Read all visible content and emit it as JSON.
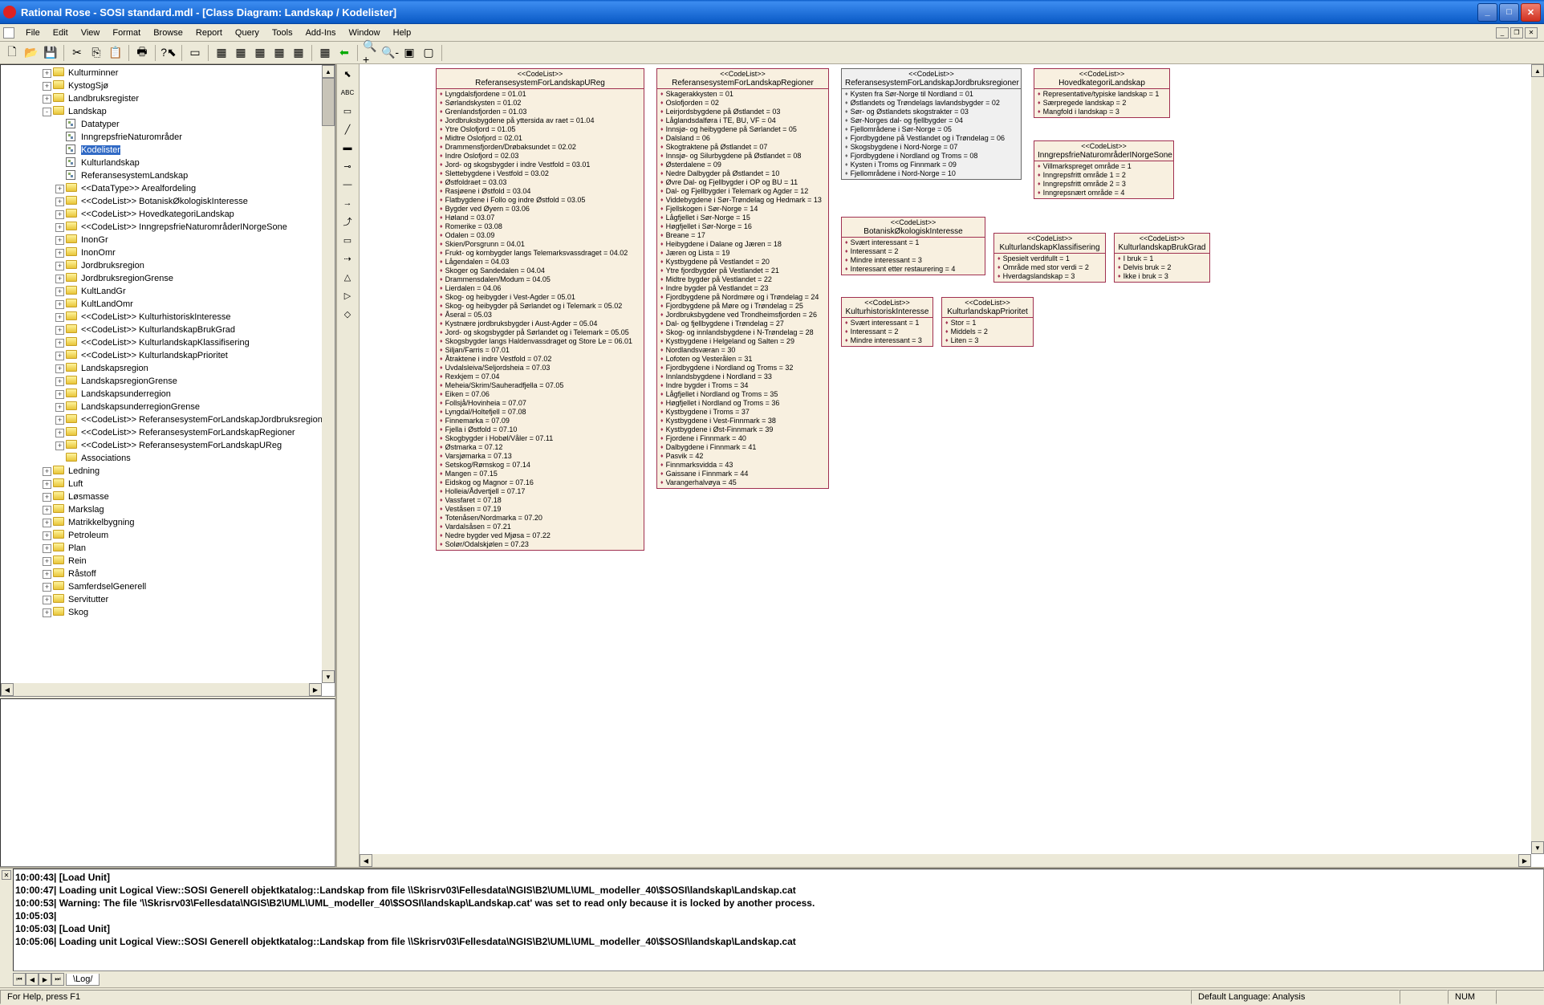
{
  "title": "Rational Rose - SOSI standard.mdl - [Class Diagram: Landskap / Kodelister]",
  "menu": [
    "File",
    "Edit",
    "View",
    "Format",
    "Browse",
    "Report",
    "Query",
    "Tools",
    "Add-Ins",
    "Window",
    "Help"
  ],
  "tree": {
    "top": [
      {
        "level": 1,
        "exp": "+",
        "icon": "folder",
        "label": "Kulturminner"
      },
      {
        "level": 1,
        "exp": "+",
        "icon": "folder",
        "label": "KystogSjø"
      },
      {
        "level": 1,
        "exp": "+",
        "icon": "folder",
        "label": "Landbruksregister"
      },
      {
        "level": 1,
        "exp": "-",
        "icon": "folder",
        "label": "Landskap"
      },
      {
        "level": 2,
        "exp": "",
        "icon": "diag",
        "label": "Datatyper"
      },
      {
        "level": 2,
        "exp": "",
        "icon": "diag",
        "label": "InngrepsfrieNaturområder"
      },
      {
        "level": 2,
        "exp": "",
        "icon": "diag",
        "label": "Kodelister",
        "selected": true
      },
      {
        "level": 2,
        "exp": "",
        "icon": "diag",
        "label": "Kulturlandskap"
      },
      {
        "level": 2,
        "exp": "",
        "icon": "diag",
        "label": "ReferansesystemLandskap"
      },
      {
        "level": 2,
        "exp": "+",
        "icon": "folder",
        "label": "<<DataType>> Arealfordeling"
      },
      {
        "level": 2,
        "exp": "+",
        "icon": "folder",
        "label": "<<CodeList>> BotaniskØkologiskInteresse"
      },
      {
        "level": 2,
        "exp": "+",
        "icon": "folder",
        "label": "<<CodeList>> HovedkategoriLandskap"
      },
      {
        "level": 2,
        "exp": "+",
        "icon": "folder",
        "label": "<<CodeList>> InngrepsfrieNaturområderINorgeSone"
      },
      {
        "level": 2,
        "exp": "+",
        "icon": "folder",
        "label": "InonGr"
      },
      {
        "level": 2,
        "exp": "+",
        "icon": "folder",
        "label": "InonOmr"
      },
      {
        "level": 2,
        "exp": "+",
        "icon": "folder",
        "label": "Jordbruksregion"
      },
      {
        "level": 2,
        "exp": "+",
        "icon": "folder",
        "label": "JordbruksregionGrense"
      },
      {
        "level": 2,
        "exp": "+",
        "icon": "folder",
        "label": "KultLandGr"
      },
      {
        "level": 2,
        "exp": "+",
        "icon": "folder",
        "label": "KultLandOmr"
      },
      {
        "level": 2,
        "exp": "+",
        "icon": "folder",
        "label": "<<CodeList>> KulturhistoriskInteresse"
      },
      {
        "level": 2,
        "exp": "+",
        "icon": "folder",
        "label": "<<CodeList>> KulturlandskapBrukGrad"
      },
      {
        "level": 2,
        "exp": "+",
        "icon": "folder",
        "label": "<<CodeList>> KulturlandskapKlassifisering"
      },
      {
        "level": 2,
        "exp": "+",
        "icon": "folder",
        "label": "<<CodeList>> KulturlandskapPrioritet"
      },
      {
        "level": 2,
        "exp": "+",
        "icon": "folder",
        "label": "Landskapsregion"
      },
      {
        "level": 2,
        "exp": "+",
        "icon": "folder",
        "label": "LandskapsregionGrense"
      },
      {
        "level": 2,
        "exp": "+",
        "icon": "folder",
        "label": "Landskapsunderregion"
      },
      {
        "level": 2,
        "exp": "+",
        "icon": "folder",
        "label": "LandskapsunderregionGrense"
      },
      {
        "level": 2,
        "exp": "+",
        "icon": "folder",
        "label": "<<CodeList>> ReferansesystemForLandskapJordbruksregioner"
      },
      {
        "level": 2,
        "exp": "+",
        "icon": "folder",
        "label": "<<CodeList>> ReferansesystemForLandskapRegioner"
      },
      {
        "level": 2,
        "exp": "+",
        "icon": "folder",
        "label": "<<CodeList>> ReferansesystemForLandskapUReg"
      },
      {
        "level": 2,
        "exp": "",
        "icon": "folder",
        "label": "Associations"
      },
      {
        "level": 1,
        "exp": "+",
        "icon": "folder",
        "label": "Ledning"
      },
      {
        "level": 1,
        "exp": "+",
        "icon": "folder",
        "label": "Luft"
      },
      {
        "level": 1,
        "exp": "+",
        "icon": "folder",
        "label": "Løsmasse"
      },
      {
        "level": 1,
        "exp": "+",
        "icon": "folder",
        "label": "Markslag"
      },
      {
        "level": 1,
        "exp": "+",
        "icon": "folder",
        "label": "Matrikkelbygning"
      },
      {
        "level": 1,
        "exp": "+",
        "icon": "folder",
        "label": "Petroleum"
      },
      {
        "level": 1,
        "exp": "+",
        "icon": "folder",
        "label": "Plan"
      },
      {
        "level": 1,
        "exp": "+",
        "icon": "folder",
        "label": "Rein"
      },
      {
        "level": 1,
        "exp": "+",
        "icon": "folder",
        "label": "Råstoff"
      },
      {
        "level": 1,
        "exp": "+",
        "icon": "folder",
        "label": "SamferdselGenerell"
      },
      {
        "level": 1,
        "exp": "+",
        "icon": "folder",
        "label": "Servitutter"
      },
      {
        "level": 1,
        "exp": "+",
        "icon": "folder",
        "label": "Skog"
      }
    ]
  },
  "stereo": "<<CodeList>>",
  "diagram": {
    "box1": {
      "name": "ReferansesystemForLandskapUReg",
      "attrs": [
        "Lyngdalsfjordene = 01.01",
        "Sørlandskysten = 01.02",
        "Grenlandsfjorden = 01.03",
        "Jordbruksbygdene på yttersida av raet = 01.04",
        "Ytre Oslofjord = 01.05",
        "Midtre Oslofjord = 02.01",
        "Drammensfjorden/Drøbaksundet = 02.02",
        "Indre Oslofjord = 02.03",
        "Jord- og skogsbygder i indre Vestfold = 03.01",
        "Slettebygdene i Vestfold = 03.02",
        "Østfoldraet = 03.03",
        "Rasjøene i Østfold = 03.04",
        "Flatbygdene i Follo og indre Østfold = 03.05",
        "Bygder ved Øyern = 03.06",
        "Høland = 03.07",
        "Romerike = 03.08",
        "Odalen = 03.09",
        "Skien/Porsgrunn = 04.01",
        "Frukt- og kornbygder langs Telemarksvassdraget = 04.02",
        "Lågendalen = 04.03",
        "Skoger og Sandedalen = 04.04",
        "Drammensdalen/Modum = 04.05",
        "Lierdalen = 04.06",
        "Skog- og heibygder i Vest-Agder = 05.01",
        "Skog- og heibygder på Sørlandet og i Telemark = 05.02",
        "Åseral = 05.03",
        "Kystnære jordbruksbygder i Aust-Agder = 05.04",
        "Jord- og skogsbygder på Sørlandet og i Telemark = 05.05",
        "Skogsbygder langs Haldenvassdraget og Store Le = 06.01",
        "Siljan/Farris = 07.01",
        "Åtraktene i indre Vestfold = 07.02",
        "Uvdalsleiva/Seljordsheia = 07.03",
        "Rexkjem = 07.04",
        "Meheia/Skrim/Sauheradfjella = 07.05",
        "Eiken = 07.06",
        "Follsjå/Hovinheia = 07.07",
        "Lyngdal/Holtefjell = 07.08",
        "Finnemarka = 07.09",
        "Fjella i Østfold = 07.10",
        "Skogbygder i Hobøl/Våler = 07.11",
        "Østmarka = 07.12",
        "Varsjømarka = 07.13",
        "Setskog/Rømskog = 07.14",
        "Mangen = 07.15",
        "Eidskog og Magnor = 07.16",
        "Holleia/Ådvertjell = 07.17",
        "Vassfaret = 07.18",
        "Veståsen = 07.19",
        "Totenåsen/Nordmarka = 07.20",
        "Vardalsåsen = 07.21",
        "Nedre bygder ved Mjøsa = 07.22",
        "Solør/Odalskjølen = 07.23"
      ]
    },
    "box2": {
      "name": "ReferansesystemForLandskapRegioner",
      "attrs": [
        "Skagerakkysten = 01",
        "Oslofjorden = 02",
        "Leirjordsbygdene på Østlandet = 03",
        "Låglandsdalføra i TE, BU, VF = 04",
        "Innsjø- og heibygdene på Sørlandet = 05",
        "Dalsland = 06",
        "Skogtraktene på Østlandet = 07",
        "Innsjø- og Silurbygdene på Østlandet = 08",
        "Østerdalene = 09",
        "Nedre Dalbygder på Østlandet = 10",
        "Øvre Dal- og Fjellbygder i OP og BU = 11",
        "Dal- og Fjellbygder i Telemark og Agder = 12",
        "Viddebygdene i Sør-Trøndelag og Hedmark = 13",
        "Fjellskogen i Sør-Norge = 14",
        "Lågfjellet i Sør-Norge = 15",
        "Høgfjellet i Sør-Norge = 16",
        "Breane = 17",
        "Heibygdene i Dalane og Jæren = 18",
        "Jæren og Lista = 19",
        "Kystbygdene på Vestlandet = 20",
        "Ytre fjordbygder på Vestlandet = 21",
        "Midtre bygder på Vestlandet = 22",
        "Indre bygder på Vestlandet = 23",
        "Fjordbygdene på Nordmøre og i Trøndelag = 24",
        "Fjordbygdene på Møre og i Trøndelag = 25",
        "Jordbruksbygdene ved Trondheimsfjorden = 26",
        "Dal- og fjellbygdene i Trøndelag = 27",
        "Skog- og innlandsbygdene i N-Trøndelag = 28",
        "Kystbygdene i Helgeland og Salten = 29",
        "Nordlandsværan = 30",
        "Lofoten og Vesterålen = 31",
        "Fjordbygdene i Nordland og Troms = 32",
        "Innlandsbygdene i Nordland = 33",
        "Indre bygder i Troms = 34",
        "Lågfjellet i Nordland og Troms = 35",
        "Høgfjellet i Nordland og Troms = 36",
        "Kystbygdene i Troms = 37",
        "Kystbygdene i Vest-Finnmark = 38",
        "Kystbygdene i Øst-Finnmark = 39",
        "Fjordene i Finnmark = 40",
        "Dalbygdene i Finnmark = 41",
        "Pasvik = 42",
        "Finnmarksvidda = 43",
        "Gaissane i Finnmark = 44",
        "Varangerhalvøya = 45"
      ]
    },
    "box3": {
      "name": "ReferansesystemForLandskapJordbruksregioner",
      "attrs": [
        "Kysten fra Sør-Norge til Nordland = 01",
        "Østlandets og Trøndelags lavlandsbygder = 02",
        "Sør- og Østlandets skogstrakter = 03",
        "Sør-Norges dal- og fjellbygder = 04",
        "Fjellområdene i Sør-Norge = 05",
        "Fjordbygdene på Vestlandet og i Trøndelag = 06",
        "Skogsbygdene i Nord-Norge = 07",
        "Fjordbygdene i Nordland og Troms = 08",
        "Kysten i Troms og Finnmark = 09",
        "Fjellområdene i Nord-Norge = 10"
      ]
    },
    "box4": {
      "name": "HovedkategoriLandskap",
      "attrs": [
        "Representative/typiske landskap = 1",
        "Særpregede landskap = 2",
        "Mangfold i landskap = 3"
      ]
    },
    "box5": {
      "name": "InngrepsfrieNaturområderINorgeSone",
      "attrs": [
        "Villmarkspreget område = 1",
        "Inngrepsfritt område 1 = 2",
        "Inngrepsfritt område 2 = 3",
        "Inngrepsnært område = 4"
      ]
    },
    "box6": {
      "name": "BotaniskØkologiskInteresse",
      "attrs": [
        "Svært interessant = 1",
        "Interessant = 2",
        "Mindre interessant = 3",
        "Interessant etter restaurering = 4"
      ]
    },
    "box7": {
      "name": "KulturlandskapKlassifisering",
      "attrs": [
        "Spesielt verdifullt = 1",
        "Område med stor verdi = 2",
        "Hverdagslandskap = 3"
      ]
    },
    "box8": {
      "name": "KulturlandskapBrukGrad",
      "attrs": [
        "I bruk = 1",
        "Delvis bruk = 2",
        "Ikke i bruk = 3"
      ]
    },
    "box9": {
      "name": "KulturhistoriskInteresse",
      "attrs": [
        "Svært interessant = 1",
        "Interessant = 2",
        "Mindre interessant = 3"
      ]
    },
    "box10": {
      "name": "KulturlandskapPrioritet",
      "attrs": [
        "Stor = 1",
        "Middels = 2",
        "Liten = 3"
      ]
    }
  },
  "log": [
    "10:00:43|  [Load Unit]",
    "10:00:47|  Loading unit Logical View::SOSI Generell objektkatalog::Landskap from file \\\\Skrisrv03\\Fellesdata\\NGIS\\B2\\UML\\UML_modeller_40\\$SOSI\\landskap\\Landskap.cat",
    "10:00:53|  Warning: The file '\\\\Skrisrv03\\Fellesdata\\NGIS\\B2\\UML\\UML_modeller_40\\$SOSI\\landskap\\Landskap.cat' was set to read only because it is locked by another process.",
    "10:05:03|",
    "10:05:03|  [Load Unit]",
    "10:05:06|  Loading unit Logical View::SOSI Generell objektkatalog::Landskap from file \\\\Skrisrv03\\Fellesdata\\NGIS\\B2\\UML\\UML_modeller_40\\$SOSI\\landskap\\Landskap.cat"
  ],
  "logtab": "Log",
  "status": {
    "help": "For Help, press F1",
    "lang": "Default Language: Analysis",
    "num": "NUM"
  }
}
